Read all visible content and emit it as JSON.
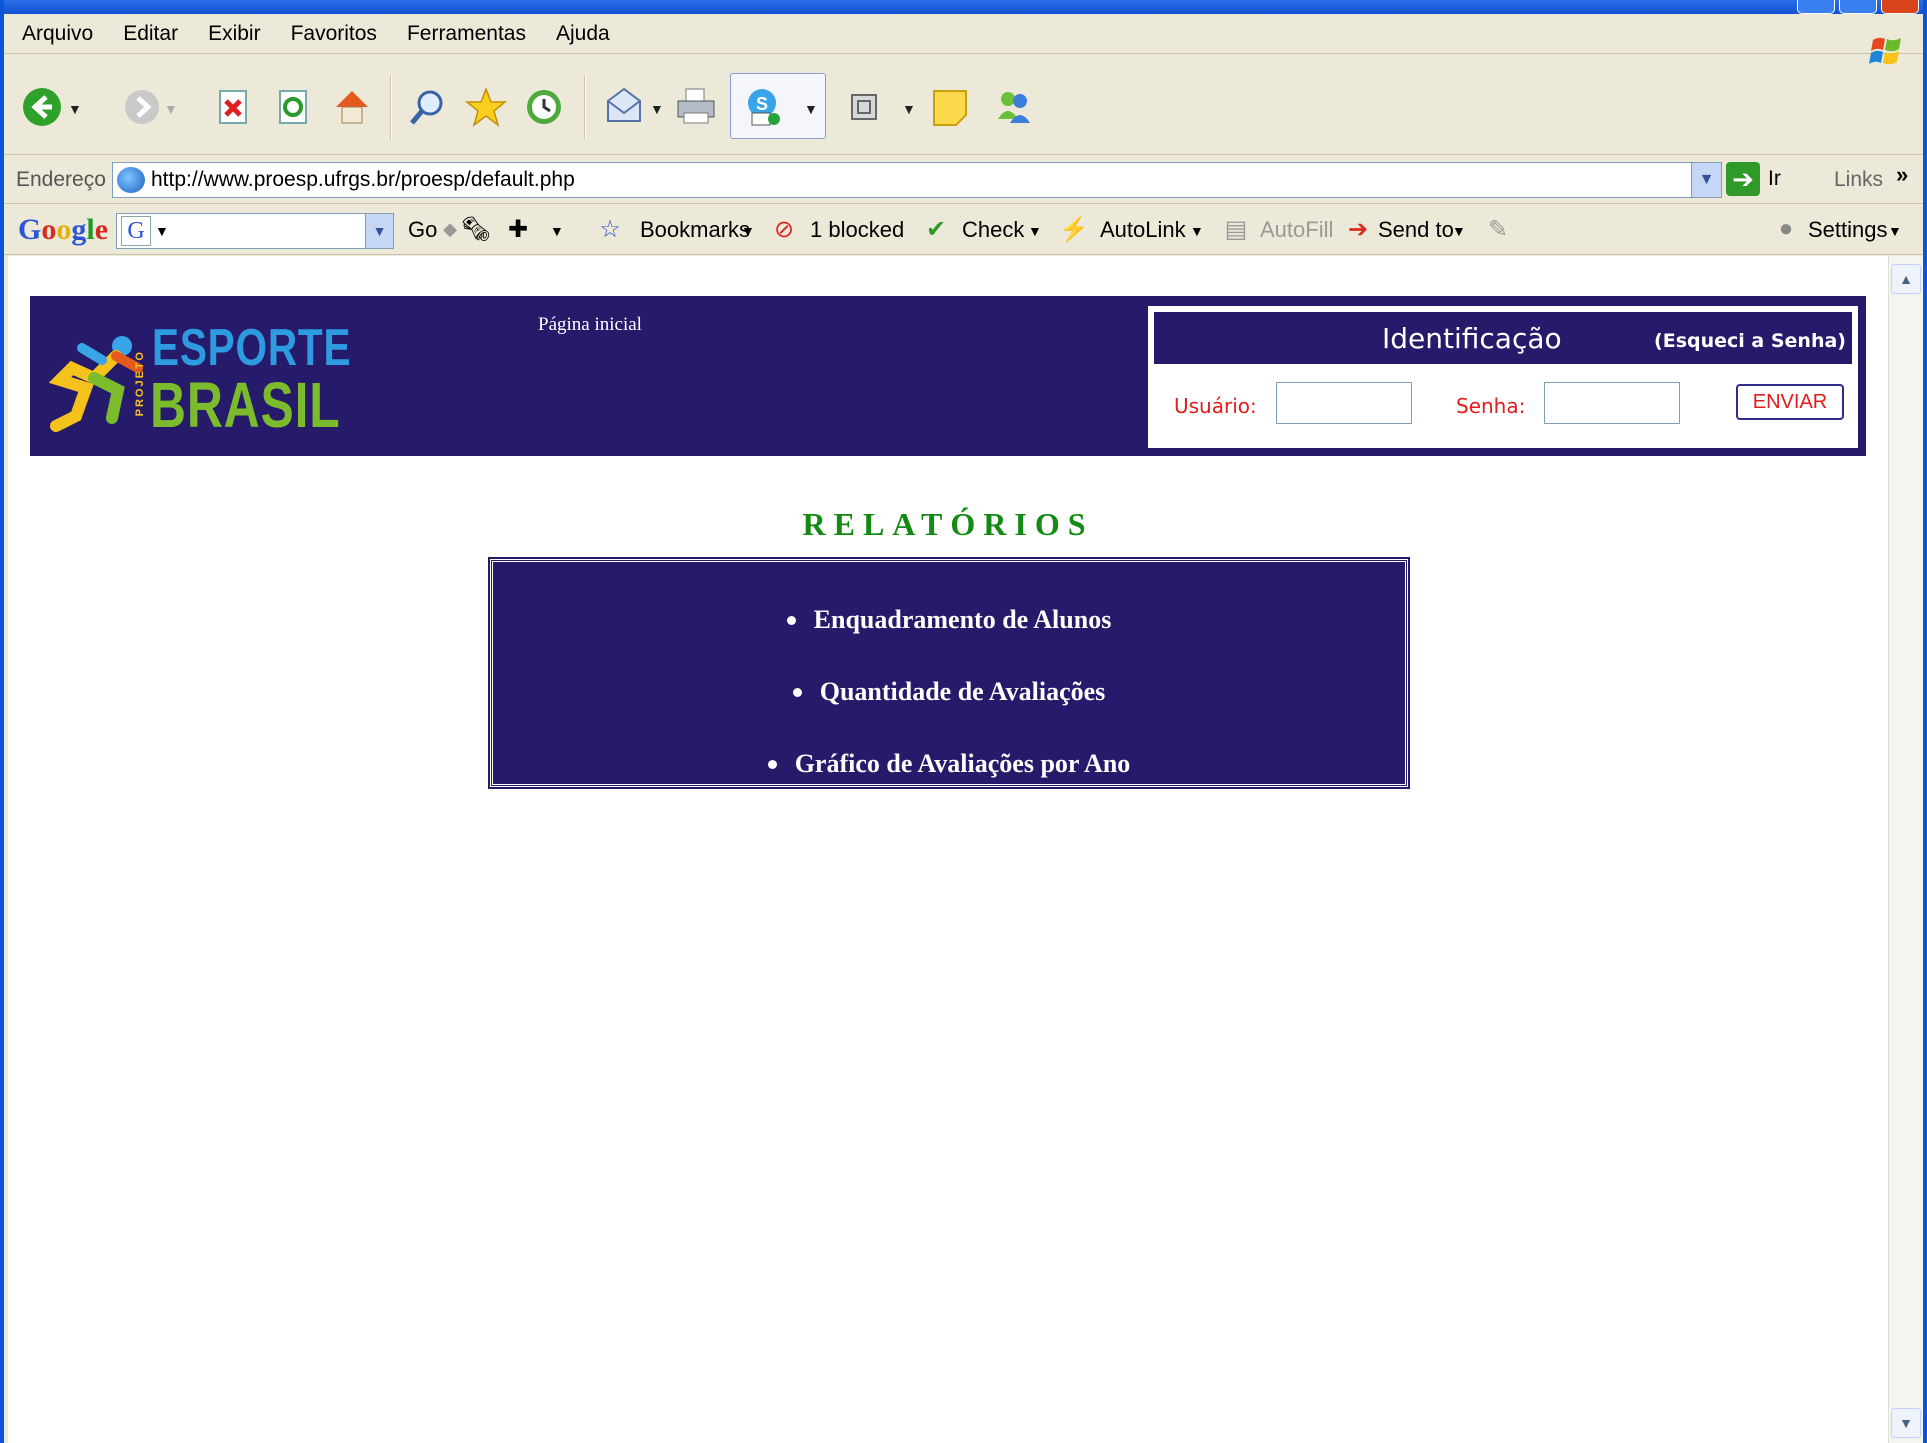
{
  "menu": [
    "Arquivo",
    "Editar",
    "Exibir",
    "Favoritos",
    "Ferramentas",
    "Ajuda"
  ],
  "address": {
    "label": "Endereço",
    "url": "http://www.proesp.ufrgs.br/proesp/default.php",
    "go_label": "Ir",
    "links_label": "Links"
  },
  "googlebar": {
    "logo": [
      "G",
      "o",
      "o",
      "g",
      "l",
      "e"
    ],
    "go_label": "Go",
    "bookmarks_label": "Bookmarks",
    "blocked_label": "1 blocked",
    "check_label": "Check",
    "autolink_label": "AutoLink",
    "autofill_label": "AutoFill",
    "sendto_label": "Send to",
    "settings_label": "Settings"
  },
  "site": {
    "logo_top": "ESPORTE",
    "logo_bottom": "BRASIL",
    "logo_vertical": "PROJETO",
    "home_link": "Página inicial",
    "login": {
      "title": "Identificação",
      "forgot": "(Esqueci a Senha)",
      "user_label": "Usuário:",
      "password_label": "Senha:",
      "user_value": "",
      "password_value": "",
      "send_label": "ENVIAR"
    },
    "reports_title": "RELATÓRIOS",
    "reports": [
      "Enquadramento de Alunos",
      "Quantidade de Avaliações",
      "Gráfico de Avaliações por Ano"
    ]
  },
  "colors": {
    "brand_navy": "#261a6b",
    "title_green": "#138a13",
    "label_red": "#e21b1b"
  }
}
